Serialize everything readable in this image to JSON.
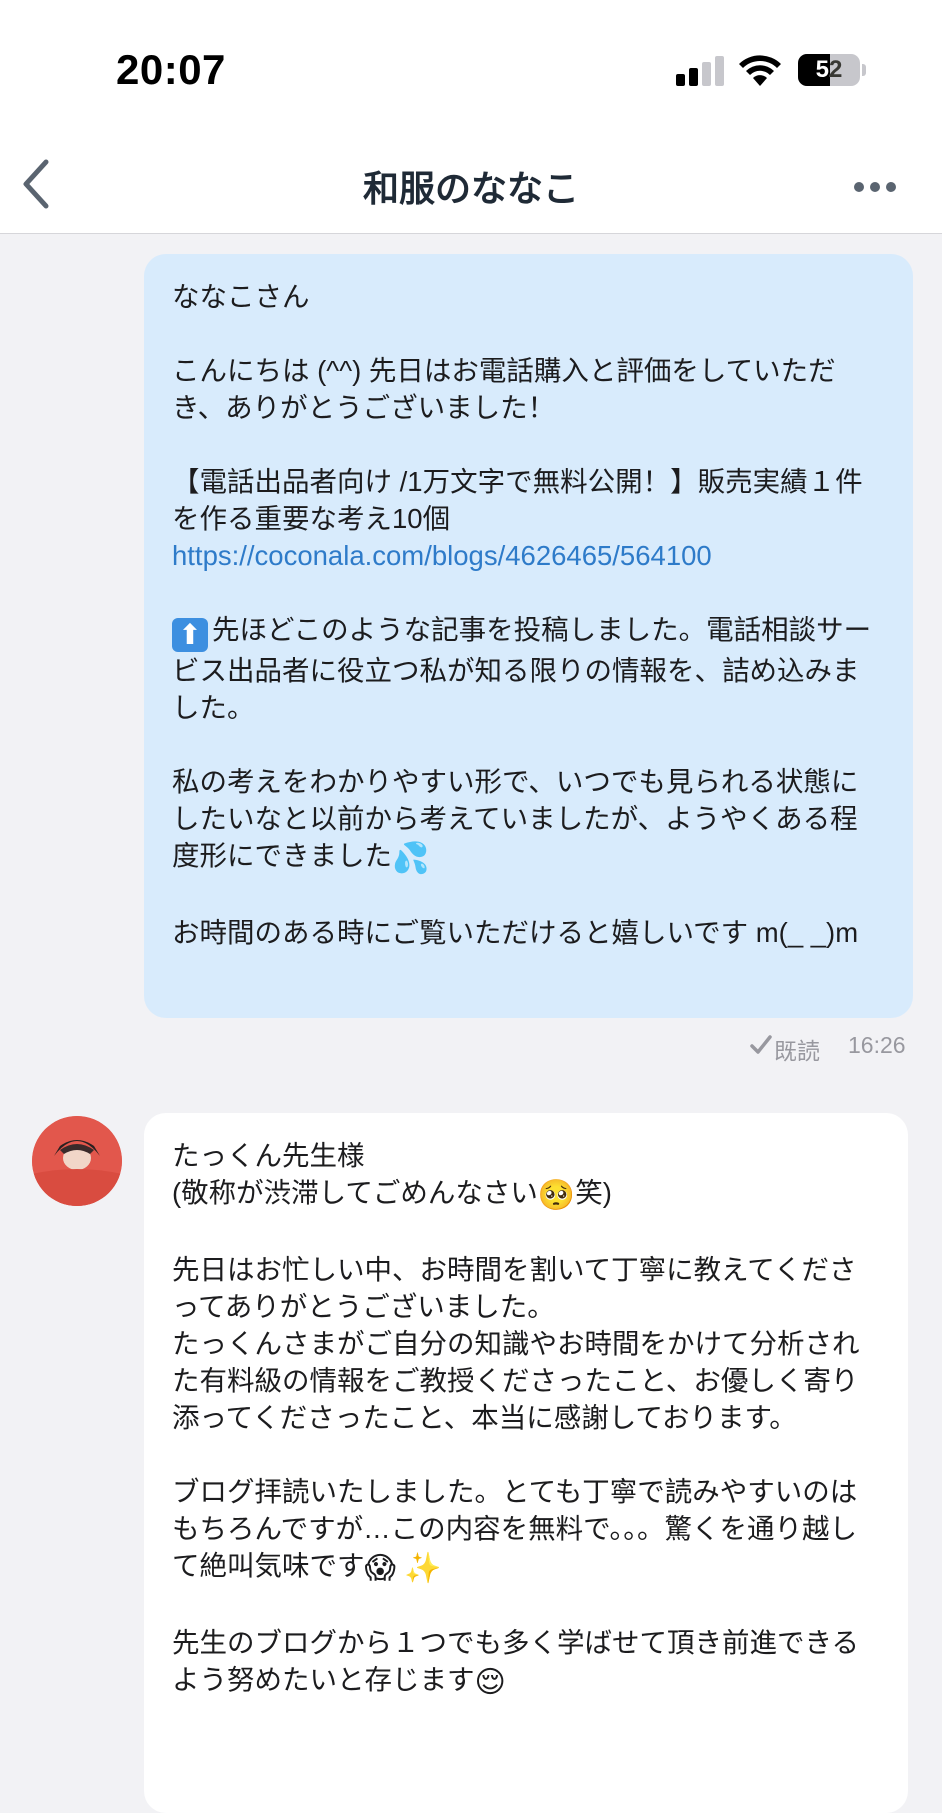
{
  "status_bar": {
    "time": "20:07",
    "battery_level": "52"
  },
  "nav": {
    "title": "和服のななこ"
  },
  "messages": {
    "outgoing": {
      "greeting": "ななこさん",
      "p1": "こんにちは (^^) 先日はお電話購入と評価をしていただき、ありがとうございました！",
      "p2": "【電話出品者向け /1万文字で無料公開！】販売実績１件を作る重要な考え10個",
      "link": "https://coconala.com/blogs/4626465/564100",
      "p3_icon": "⬆",
      "p3": "先ほどこのような記事を投稿しました。電話相談サービス出品者に役立つ私が知る限りの情報を、詰め込みました。",
      "p4": "私の考えをわかりやすい形で、いつでも見られる状態にしたいなと以前から考えていましたが、ようやくある程度形にできました",
      "p4_emoji": "💦",
      "p5": "お時間のある時にご覧いただけると嬉しいです m(_ _)m",
      "read_label": "既読",
      "time": "16:26"
    },
    "incoming": {
      "line1": "たっくん先生様",
      "line2a": "(敬称が渋滞してごめんなさい",
      "line2_emoji": "🥺",
      "line2b": "笑)",
      "p2": "先日はお忙しい中、お時間を割いて丁寧に教えてくださってありがとうございました。\nたっくんさまがご自分の知識やお時間をかけて分析された有料級の情報をご教授くださったこと、お優しく寄り添ってくださったこと、本当に感謝しております。",
      "p3": "ブログ拝読いたしました。とても丁寧で読みやすいのはもちろんですが…この内容を無料で。。。驚くを通り越して絶叫気味です",
      "p3_emoji": "😱 ✨",
      "p4": "先生のブログから１つでも多く学ばせて頂き前進できるよう努めたいと存じます",
      "p4_emoji": "😌"
    }
  },
  "colors": {
    "outgoing_bubble": "#d8ebfc",
    "incoming_bubble": "#ffffff",
    "link": "#2e7bc9",
    "avatar_bg": "#e2574c"
  },
  "icons": {
    "back": "chevron-left-icon",
    "more": "more-icon",
    "read": "check-icon"
  }
}
